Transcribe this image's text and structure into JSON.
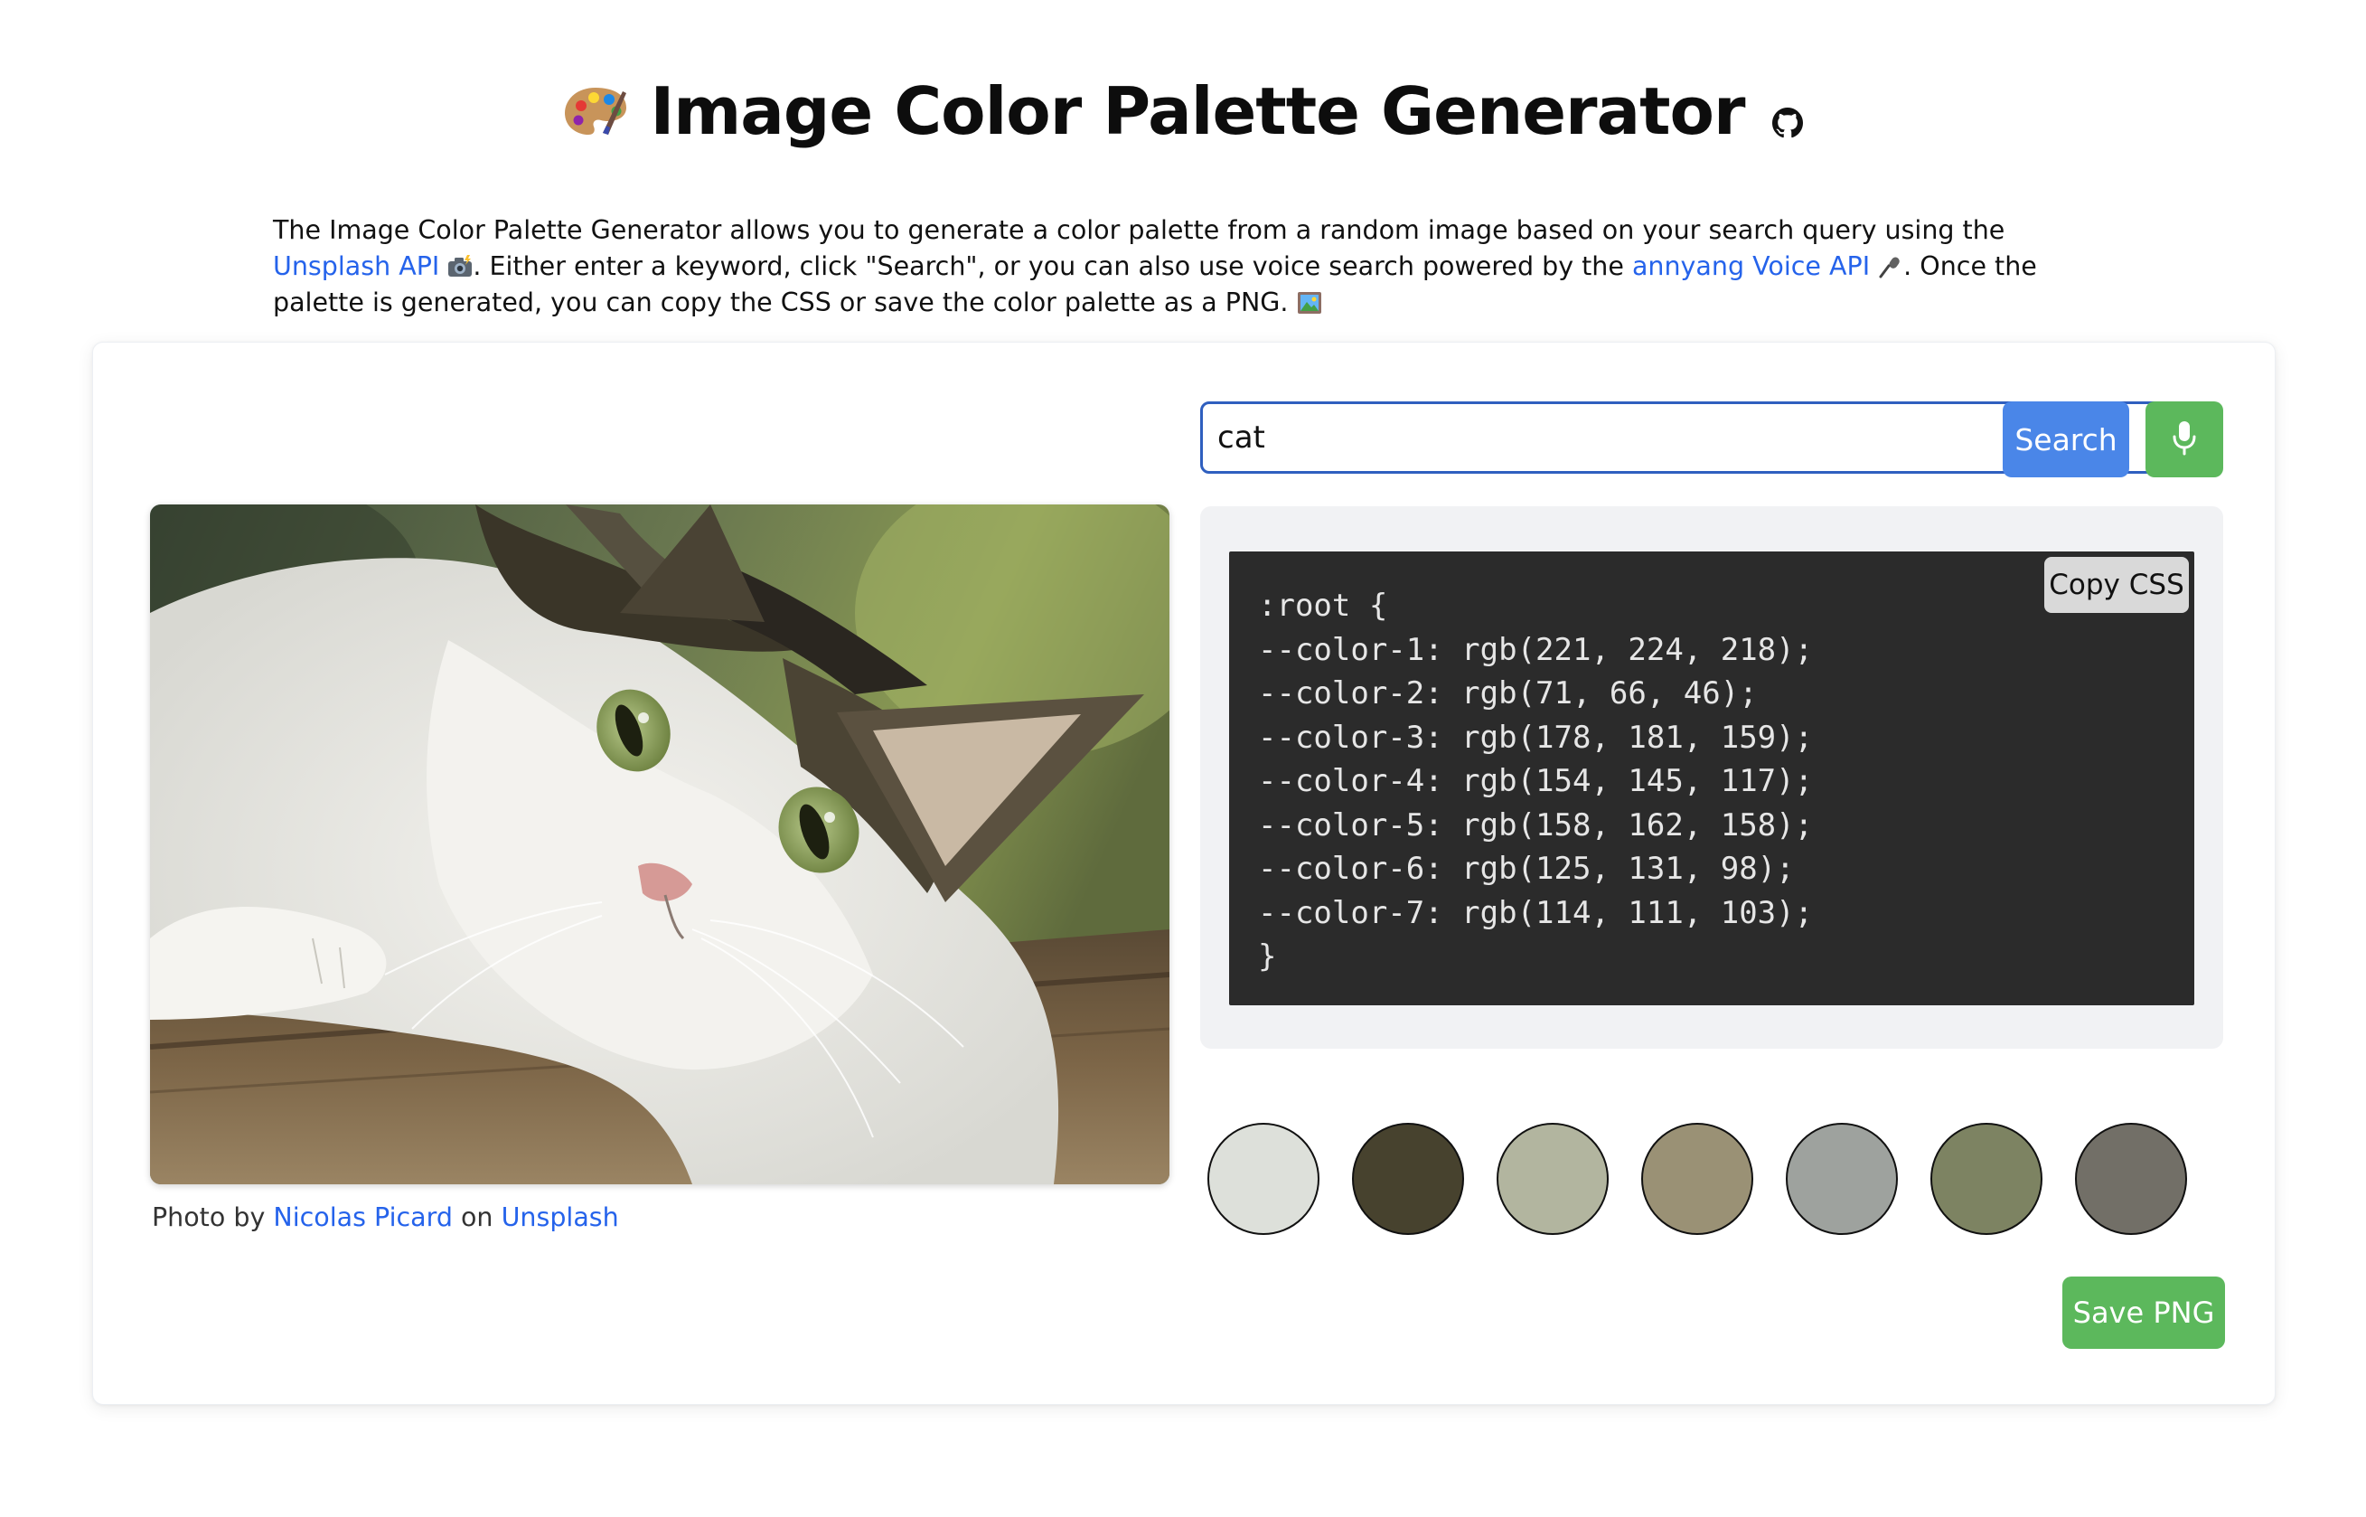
{
  "header": {
    "title": "Image Color Palette Generator",
    "title_icon": "artist-palette-emoji",
    "repo_link_icon": "github-icon"
  },
  "intro": {
    "text_1": "The Image Color Palette Generator allows you to generate a color palette from a random image based on your search query using the ",
    "unsplash_api_link": "Unsplash API",
    "text_2": ". Either enter a keyword, click \"Search\", or you can also use voice search powered by the ",
    "voice_api_link": "annyang Voice API",
    "text_3": ". Once the palette is generated, you can copy the CSS or save the color palette as a PNG.",
    "emoji_1": "camera-flash-emoji",
    "emoji_2": "microphone-emoji",
    "emoji_3": "framed-picture-emoji"
  },
  "search": {
    "value": "cat",
    "button_label": "Search",
    "voice_icon": "microphone-icon"
  },
  "photo": {
    "subject": "cat",
    "credit_prefix": "Photo by ",
    "author": "Nicolas Picard",
    "credit_mid": " on ",
    "source": "Unsplash"
  },
  "css_output": {
    "copy_label": "Copy CSS",
    "lines": [
      ":root {",
      "--color-1: rgb(221, 224, 218);",
      "--color-2: rgb(71, 66, 46);",
      "--color-3: rgb(178, 181, 159);",
      "--color-4: rgb(154, 145, 117);",
      "--color-5: rgb(158, 162, 158);",
      "--color-6: rgb(125, 131, 98);",
      "--color-7: rgb(114, 111, 103);",
      "}"
    ]
  },
  "palette": [
    "rgb(221, 224, 218)",
    "rgb(71, 66, 46)",
    "rgb(178, 181, 159)",
    "rgb(154, 145, 117)",
    "rgb(158, 162, 158)",
    "rgb(125, 131, 98)",
    "rgb(114, 111, 103)"
  ],
  "actions": {
    "save_label": "Save PNG"
  },
  "colors": {
    "link": "#2563eb",
    "search_button": "#4a86e8",
    "green_button": "#5cb85c",
    "code_bg": "#2b2b2b",
    "panel_bg": "#f1f2f4"
  }
}
